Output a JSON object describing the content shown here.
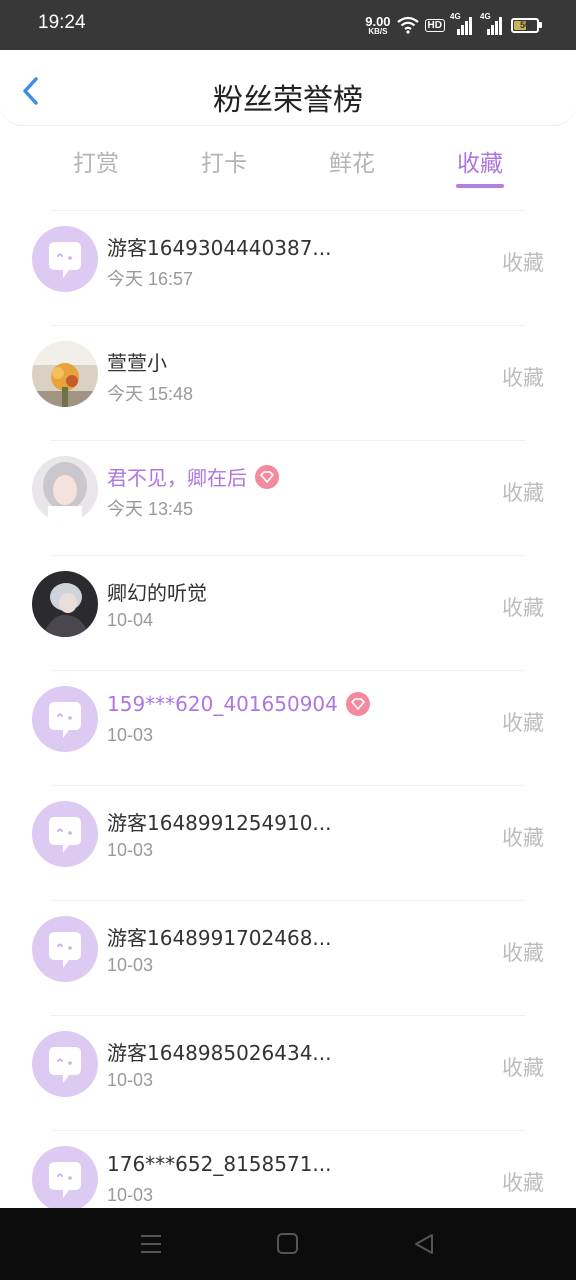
{
  "status_bar": {
    "time": "19:24",
    "speed_value": "9.00",
    "speed_unit": "KB/S",
    "hd": "HD",
    "signal1": "4G",
    "signal2": "4G",
    "battery": "50"
  },
  "header": {
    "title": "粉丝荣誉榜"
  },
  "tabs": [
    {
      "label": "打赏"
    },
    {
      "label": "打卡"
    },
    {
      "label": "鲜花"
    },
    {
      "label": "收藏"
    }
  ],
  "active_tab": "收藏",
  "colors": {
    "accent": "#ae77e0",
    "vip_badge": "#f58a9e",
    "avatar_bg": "#dccaf3"
  },
  "rows": [
    {
      "name": "游客1649304440387...",
      "time": "今天 16:57",
      "action": "收藏"
    },
    {
      "name": "萱萱小",
      "time": "今天 15:48",
      "action": "收藏"
    },
    {
      "name": "君不见，卿在后",
      "time": "今天 13:45",
      "action": "收藏"
    },
    {
      "name": "卿幻的听觉",
      "time": "10-04",
      "action": "收藏"
    },
    {
      "name": "159***620_401650904",
      "time": "10-03",
      "action": "收藏"
    },
    {
      "name": "游客1648991254910...",
      "time": "10-03",
      "action": "收藏"
    },
    {
      "name": "游客1648991702468...",
      "time": "10-03",
      "action": "收藏"
    },
    {
      "name": "游客1648985026434...",
      "time": "10-03",
      "action": "收藏"
    },
    {
      "name": "176***652_8158571...",
      "time": "10-03",
      "action": "收藏"
    }
  ]
}
